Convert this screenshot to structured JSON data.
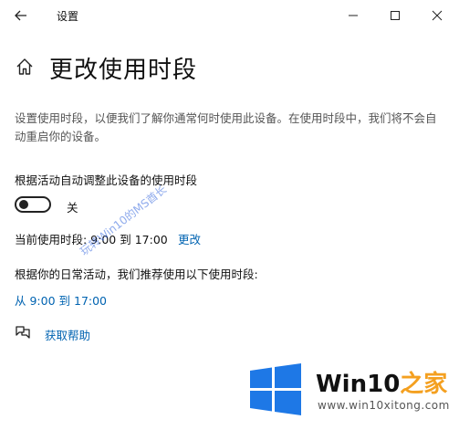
{
  "window": {
    "title": "设置"
  },
  "page": {
    "title": "更改使用时段",
    "description": "设置使用时段，以便我们了解你通常何时使用此设备。在使用时段中，我们将不会自动重启你的设备。"
  },
  "auto_adjust": {
    "label": "根据活动自动调整此设备的使用时段",
    "state_label": "关",
    "enabled": false
  },
  "current_hours": {
    "text": "当前使用时段: 9:00 到 17:00",
    "change_link": "更改"
  },
  "recommendation": {
    "label": "根据你的日常活动，我们推荐使用以下使用时段:",
    "link": "从 9:00 到 17:00"
  },
  "help": {
    "link": "获取帮助"
  },
  "watermark": {
    "diagonal_text": "玩转Win10的MS酋长"
  },
  "brand": {
    "name_prefix": "Win10",
    "name_suffix": "之家",
    "url": "www.win10xitong.com",
    "colors": {
      "blue": "#1e78e6",
      "orange": "#f4a020"
    }
  },
  "colors": {
    "link": "#0063b1",
    "description": "#555555"
  },
  "icons": {
    "back": "back-arrow-icon",
    "minimize": "minimize-icon",
    "maximize": "maximize-icon",
    "close": "close-icon",
    "home": "home-icon",
    "help": "help-chat-icon",
    "logo": "windows-logo-icon"
  }
}
